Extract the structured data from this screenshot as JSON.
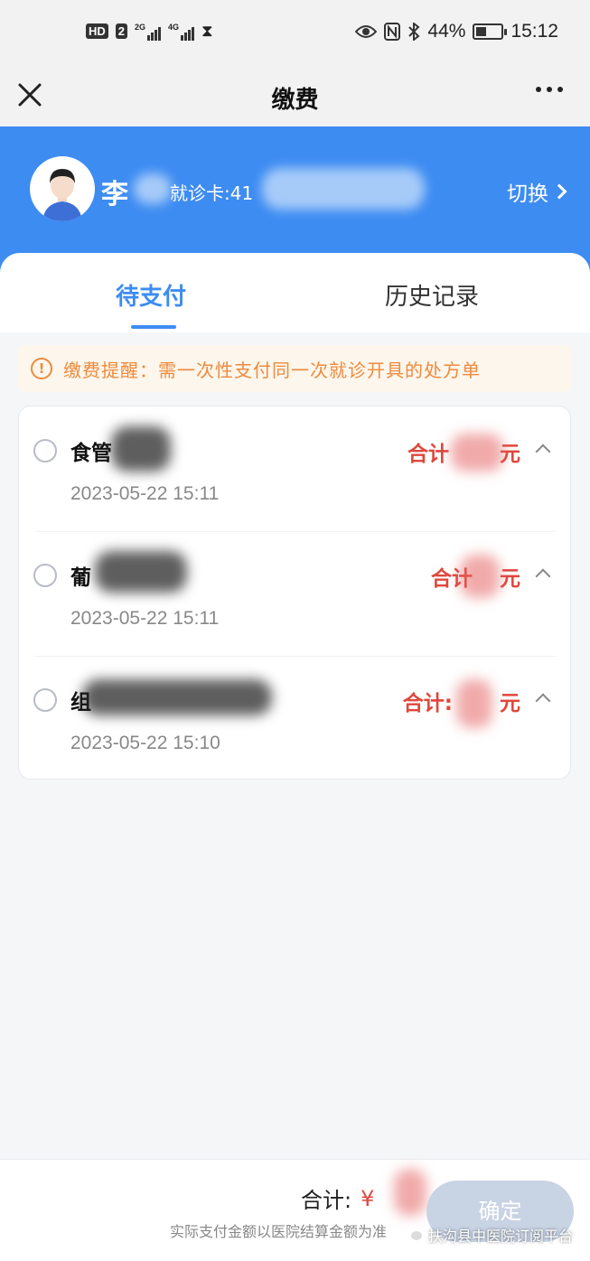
{
  "status_bar": {
    "hd_label": "HD",
    "sim_label": "2",
    "net1": "2G",
    "net2": "4G",
    "battery_text": "44%",
    "battery_level": 0.44,
    "time": "15:12"
  },
  "nav": {
    "title": "缴费"
  },
  "patient": {
    "name": "李",
    "card_label": "就诊卡:41",
    "switch_label": "切换"
  },
  "tabs": [
    {
      "label": "待支付",
      "active": true
    },
    {
      "label": "历史记录",
      "active": false
    }
  ],
  "reminder": {
    "text": "缴费提醒：需一次性支付同一次就诊开具的处方单",
    "color": "#ee8a3c"
  },
  "bills": [
    {
      "name": "食管",
      "time": "2023-05-22 15:11",
      "total_prefix": "合计",
      "total_suffix": "元"
    },
    {
      "name": "葡",
      "time": "2023-05-22 15:11",
      "total_prefix": "合计",
      "total_suffix": "元"
    },
    {
      "name": "组",
      "time": "2023-05-22 15:10",
      "total_prefix": "合计:",
      "total_suffix": "元"
    }
  ],
  "footer": {
    "total_label": "合计:",
    "currency": "¥",
    "note": "实际支付金额以医院结算金额为准",
    "confirm_label": "确定"
  },
  "watermark": "扶沟县中医院订阅平台",
  "colors": {
    "primary": "#3d8cf2",
    "price_red": "#e0463c",
    "disabled_button": "#c8d3e4"
  }
}
